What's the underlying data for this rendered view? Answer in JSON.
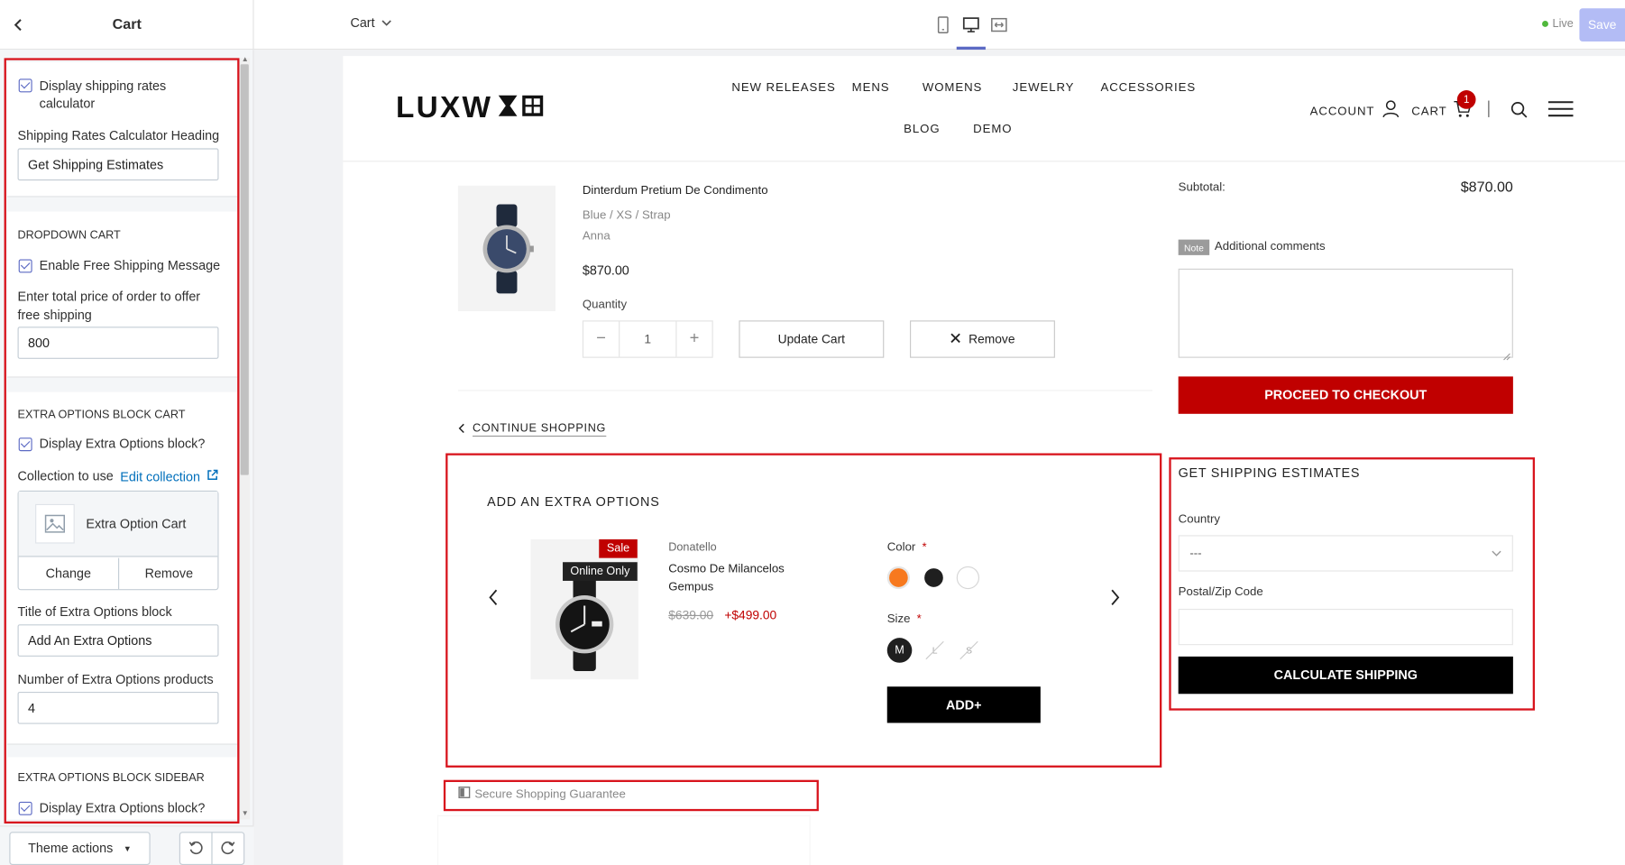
{
  "editor": {
    "page_title": "Cart",
    "template_select": "Cart",
    "live_label": "Live",
    "save_label": "Save",
    "theme_actions_label": "Theme actions"
  },
  "sidebar": {
    "shipping": {
      "display_calculator_label": "Display shipping rates calculator",
      "display_calculator_checked": true,
      "heading_label": "Shipping Rates Calculator Heading",
      "heading_value": "Get Shipping Estimates"
    },
    "dropdown_cart": {
      "title": "DROPDOWN CART",
      "free_shipping_label": "Enable Free Shipping Message",
      "free_shipping_checked": true,
      "price_label_line1": "Enter total price of order to offer",
      "price_label_line2": "free shipping",
      "price_value": "800"
    },
    "extra_options_cart": {
      "title": "EXTRA OPTIONS BLOCK CART",
      "display_label": "Display Extra Options block?",
      "display_checked": true,
      "collection_label": "Collection to use",
      "edit_collection_label": "Edit collection",
      "collection_name": "Extra Option Cart",
      "change_label": "Change",
      "remove_label": "Remove",
      "block_title_label": "Title of Extra Options block",
      "block_title_value": "Add An Extra Options",
      "count_label": "Number of Extra Options products",
      "count_value": "4"
    },
    "extra_options_sidebar": {
      "title": "EXTRA OPTIONS BLOCK SIDEBAR",
      "display_label": "Display Extra Options block?",
      "display_checked": true
    }
  },
  "store": {
    "logo": "LUXW",
    "nav": [
      "NEW RELEASES",
      "MENS",
      "WOMENS",
      "JEWELRY",
      "ACCESSORIES",
      "BLOG",
      "DEMO"
    ],
    "account_label": "ACCOUNT",
    "cart_label": "CART",
    "cart_count": "1",
    "cart_item": {
      "name": "Dinterdum Pretium De Condimento",
      "variant": "Blue / XS / Strap",
      "vendor": "Anna",
      "price": "$870.00",
      "quantity_label": "Quantity",
      "quantity": "1",
      "update_label": "Update Cart",
      "remove_label": "Remove"
    },
    "summary": {
      "subtotal_label": "Subtotal:",
      "subtotal_value": "$870.00",
      "note_badge": "Note",
      "note_label": "Additional comments",
      "checkout_label": "PROCEED TO CHECKOUT"
    },
    "continue_label": "CONTINUE SHOPPING",
    "extra_options": {
      "title": "ADD AN EXTRA OPTIONS",
      "sale_badge": "Sale",
      "online_badge": "Online Only",
      "vendor": "Donatello",
      "name_line1": "Cosmo De Milancelos",
      "name_line2": "Gempus",
      "old_price": "$639.00",
      "new_price": "+$499.00",
      "color_label": "Color",
      "size_label": "Size",
      "required_mark": "*",
      "sizes": [
        "M",
        "L",
        "S"
      ],
      "add_label": "ADD+",
      "colors": [
        "#f7791e",
        "#1f1f1f",
        "#ffffff"
      ]
    },
    "shipping_estimates": {
      "title": "GET SHIPPING ESTIMATES",
      "country_label": "Country",
      "country_value": "---",
      "zip_label": "Postal/Zip Code",
      "zip_value": "",
      "calculate_label": "CALCULATE SHIPPING"
    },
    "secure_label": "Secure Shopping Guarantee"
  },
  "colors": {
    "accent": "#5c6ac4",
    "checkout_red": "#c00000",
    "highlight_red": "#d8141d",
    "live_green": "#50b83c",
    "price_red": "#c00000"
  }
}
